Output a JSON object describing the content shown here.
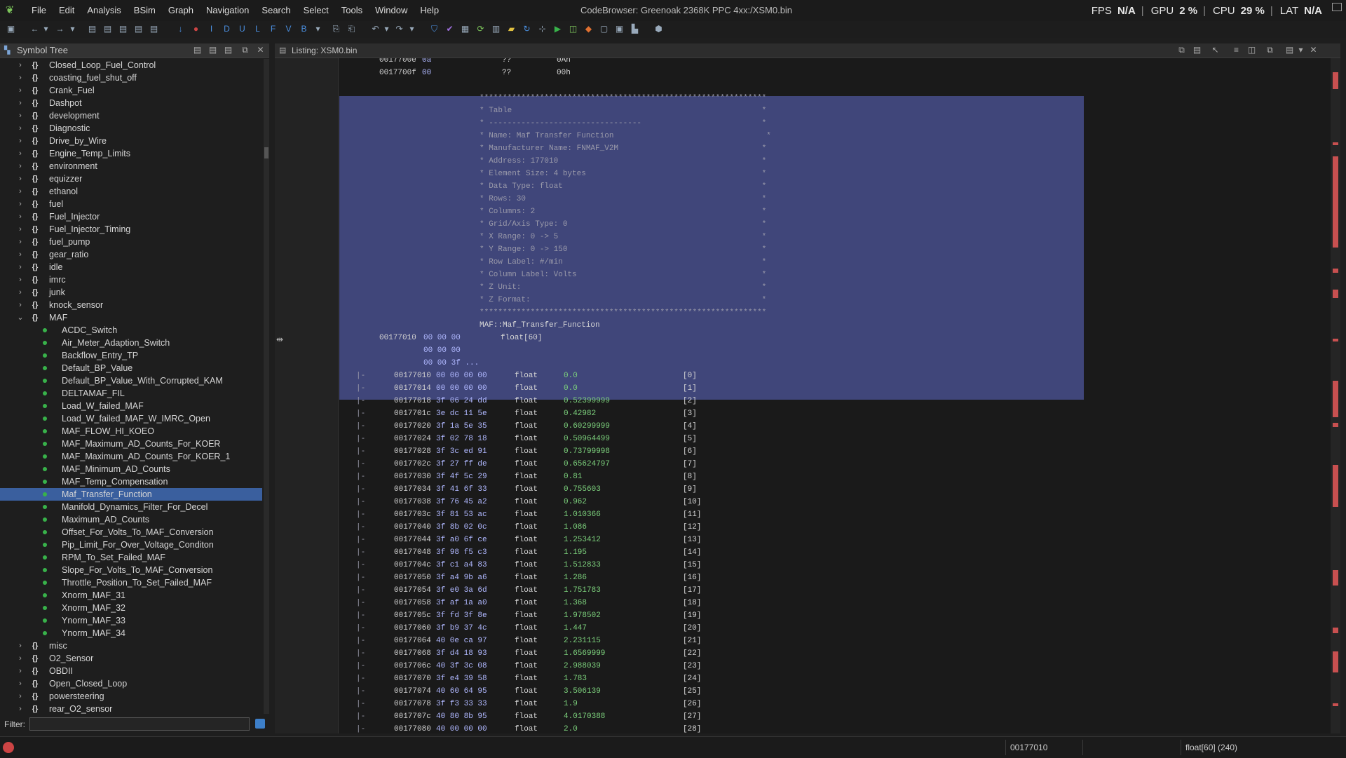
{
  "menubar": {
    "items": [
      "File",
      "Edit",
      "Analysis",
      "BSim",
      "Graph",
      "Navigation",
      "Search",
      "Select",
      "Tools",
      "Window",
      "Help"
    ],
    "title": "CodeBrowser: Greenoak 2368K PPC 4xx:/XSM0.bin",
    "perf": {
      "fps_label": "FPS",
      "fps_value": "N/A",
      "gpu_label": "GPU",
      "gpu_value": "2 %",
      "cpu_label": "CPU",
      "cpu_value": "29 %",
      "lat_label": "LAT",
      "lat_value": "N/A"
    }
  },
  "symbol_tree": {
    "title": "Symbol Tree",
    "filter_label": "Filter:",
    "filter_value": "",
    "items": [
      {
        "label": "Closed_Loop_Fuel_Control",
        "level": 0,
        "kind": "ns",
        "expanded": false
      },
      {
        "label": "coasting_fuel_shut_off",
        "level": 0,
        "kind": "ns",
        "expanded": false
      },
      {
        "label": "Crank_Fuel",
        "level": 0,
        "kind": "ns",
        "expanded": false
      },
      {
        "label": "Dashpot",
        "level": 0,
        "kind": "ns",
        "expanded": false
      },
      {
        "label": "development",
        "level": 0,
        "kind": "ns",
        "expanded": false
      },
      {
        "label": "Diagnostic",
        "level": 0,
        "kind": "ns",
        "expanded": false
      },
      {
        "label": "Drive_by_Wire",
        "level": 0,
        "kind": "ns",
        "expanded": false
      },
      {
        "label": "Engine_Temp_Limits",
        "level": 0,
        "kind": "ns",
        "expanded": false
      },
      {
        "label": "environment",
        "level": 0,
        "kind": "ns",
        "expanded": false
      },
      {
        "label": "equizzer",
        "level": 0,
        "kind": "ns",
        "expanded": false
      },
      {
        "label": "ethanol",
        "level": 0,
        "kind": "ns",
        "expanded": false
      },
      {
        "label": "fuel",
        "level": 0,
        "kind": "ns",
        "expanded": false
      },
      {
        "label": "Fuel_Injector",
        "level": 0,
        "kind": "ns",
        "expanded": false
      },
      {
        "label": "Fuel_Injector_Timing",
        "level": 0,
        "kind": "ns",
        "expanded": false
      },
      {
        "label": "fuel_pump",
        "level": 0,
        "kind": "ns",
        "expanded": false
      },
      {
        "label": "gear_ratio",
        "level": 0,
        "kind": "ns",
        "expanded": false
      },
      {
        "label": "idle",
        "level": 0,
        "kind": "ns",
        "expanded": false
      },
      {
        "label": "imrc",
        "level": 0,
        "kind": "ns",
        "expanded": false
      },
      {
        "label": "junk",
        "level": 0,
        "kind": "ns",
        "expanded": false
      },
      {
        "label": "knock_sensor",
        "level": 0,
        "kind": "ns",
        "expanded": false
      },
      {
        "label": "MAF",
        "level": 0,
        "kind": "ns",
        "expanded": true
      },
      {
        "label": "ACDC_Switch",
        "level": 1,
        "kind": "label"
      },
      {
        "label": "Air_Meter_Adaption_Switch",
        "level": 1,
        "kind": "label"
      },
      {
        "label": "Backflow_Entry_TP",
        "level": 1,
        "kind": "label"
      },
      {
        "label": "Default_BP_Value",
        "level": 1,
        "kind": "label"
      },
      {
        "label": "Default_BP_Value_With_Corrupted_KAM",
        "level": 1,
        "kind": "label"
      },
      {
        "label": "DELTAMAF_FIL",
        "level": 1,
        "kind": "label"
      },
      {
        "label": "Load_W_failed_MAF",
        "level": 1,
        "kind": "label"
      },
      {
        "label": "Load_W_failed_MAF_W_IMRC_Open",
        "level": 1,
        "kind": "label"
      },
      {
        "label": "MAF_FLOW_HI_KOEO",
        "level": 1,
        "kind": "label"
      },
      {
        "label": "MAF_Maximum_AD_Counts_For_KOER",
        "level": 1,
        "kind": "label"
      },
      {
        "label": "MAF_Maximum_AD_Counts_For_KOER_1",
        "level": 1,
        "kind": "label"
      },
      {
        "label": "MAF_Minimum_AD_Counts",
        "level": 1,
        "kind": "label"
      },
      {
        "label": "MAF_Temp_Compensation",
        "level": 1,
        "kind": "label"
      },
      {
        "label": "Maf_Transfer_Function",
        "level": 1,
        "kind": "label",
        "selected": true
      },
      {
        "label": "Manifold_Dynamics_Filter_For_Decel",
        "level": 1,
        "kind": "label"
      },
      {
        "label": "Maximum_AD_Counts",
        "level": 1,
        "kind": "label"
      },
      {
        "label": "Offset_For_Volts_To_MAF_Conversion",
        "level": 1,
        "kind": "label"
      },
      {
        "label": "Pip_Limit_For_Over_Voltage_Conditon",
        "level": 1,
        "kind": "label"
      },
      {
        "label": "RPM_To_Set_Failed_MAF",
        "level": 1,
        "kind": "label"
      },
      {
        "label": "Slope_For_Volts_To_MAF_Conversion",
        "level": 1,
        "kind": "label"
      },
      {
        "label": "Throttle_Position_To_Set_Failed_MAF",
        "level": 1,
        "kind": "label"
      },
      {
        "label": "Xnorm_MAF_31",
        "level": 1,
        "kind": "label"
      },
      {
        "label": "Xnorm_MAF_32",
        "level": 1,
        "kind": "label"
      },
      {
        "label": "Ynorm_MAF_33",
        "level": 1,
        "kind": "label"
      },
      {
        "label": "Ynorm_MAF_34",
        "level": 1,
        "kind": "label"
      },
      {
        "label": "misc",
        "level": 0,
        "kind": "ns",
        "expanded": false
      },
      {
        "label": "O2_Sensor",
        "level": 0,
        "kind": "ns",
        "expanded": false
      },
      {
        "label": "OBDII",
        "level": 0,
        "kind": "ns",
        "expanded": false
      },
      {
        "label": "Open_Closed_Loop",
        "level": 0,
        "kind": "ns",
        "expanded": false
      },
      {
        "label": "powersteering",
        "level": 0,
        "kind": "ns",
        "expanded": false
      },
      {
        "label": "rear_O2_sensor",
        "level": 0,
        "kind": "ns",
        "expanded": false
      }
    ]
  },
  "listing": {
    "title": "Listing:  XSM0.bin",
    "pre_lines": [
      {
        "addr": "0017700e",
        "bytes": "0a",
        "mnem": "??",
        "val": "0Ah"
      },
      {
        "addr": "0017700f",
        "bytes": "00",
        "mnem": "??",
        "val": "00h"
      }
    ],
    "comment_lines": [
      "**************************************************************",
      "* Table                                                      *",
      "* ---------------------------------                          *",
      "* Name: Maf Transfer Function                                 *",
      "* Manufacturer Name: FNMAF_V2M                               *",
      "* Address: 177010                                            *",
      "* Element Size: 4 bytes                                      *",
      "* Data Type: float                                           *",
      "* Rows: 30                                                   *",
      "* Columns: 2                                                 *",
      "* Grid/Axis Type: 0                                          *",
      "* X Range: 0 -> 5                                            *",
      "* Y Range: 0 -> 150                                          *",
      "* Row Label: #/min                                           *",
      "* Column Label: Volts                                        *",
      "* Z Unit:                                                    *",
      "* Z Format:                                                  *",
      "**************************************************************"
    ],
    "label_line": "MAF::Maf_Transfer_Function",
    "array_line": {
      "addr": "00177010",
      "bytes": [
        "00 00 00",
        "00 00 00",
        "00 00 3f ..."
      ],
      "type": "float[60]"
    },
    "rows": [
      {
        "addr": "00177010",
        "bytes": "00 00 00 00",
        "mnem": "float",
        "val": "0.0",
        "idx": "[0]"
      },
      {
        "addr": "00177014",
        "bytes": "00 00 00 00",
        "mnem": "float",
        "val": "0.0",
        "idx": "[1]"
      },
      {
        "addr": "00177018",
        "bytes": "3f 06 24 dd",
        "mnem": "float",
        "val": "0.52399999",
        "idx": "[2]"
      },
      {
        "addr": "0017701c",
        "bytes": "3e dc 11 5e",
        "mnem": "float",
        "val": "0.42982",
        "idx": "[3]"
      },
      {
        "addr": "00177020",
        "bytes": "3f 1a 5e 35",
        "mnem": "float",
        "val": "0.60299999",
        "idx": "[4]"
      },
      {
        "addr": "00177024",
        "bytes": "3f 02 78 18",
        "mnem": "float",
        "val": "0.50964499",
        "idx": "[5]"
      },
      {
        "addr": "00177028",
        "bytes": "3f 3c ed 91",
        "mnem": "float",
        "val": "0.73799998",
        "idx": "[6]"
      },
      {
        "addr": "0017702c",
        "bytes": "3f 27 ff de",
        "mnem": "float",
        "val": "0.65624797",
        "idx": "[7]"
      },
      {
        "addr": "00177030",
        "bytes": "3f 4f 5c 29",
        "mnem": "float",
        "val": "0.81",
        "idx": "[8]"
      },
      {
        "addr": "00177034",
        "bytes": "3f 41 6f 33",
        "mnem": "float",
        "val": "0.755603",
        "idx": "[9]"
      },
      {
        "addr": "00177038",
        "bytes": "3f 76 45 a2",
        "mnem": "float",
        "val": "0.962",
        "idx": "[10]"
      },
      {
        "addr": "0017703c",
        "bytes": "3f 81 53 ac",
        "mnem": "float",
        "val": "1.010366",
        "idx": "[11]"
      },
      {
        "addr": "00177040",
        "bytes": "3f 8b 02 0c",
        "mnem": "float",
        "val": "1.086",
        "idx": "[12]"
      },
      {
        "addr": "00177044",
        "bytes": "3f a0 6f ce",
        "mnem": "float",
        "val": "1.253412",
        "idx": "[13]"
      },
      {
        "addr": "00177048",
        "bytes": "3f 98 f5 c3",
        "mnem": "float",
        "val": "1.195",
        "idx": "[14]"
      },
      {
        "addr": "0017704c",
        "bytes": "3f c1 a4 83",
        "mnem": "float",
        "val": "1.512833",
        "idx": "[15]"
      },
      {
        "addr": "00177050",
        "bytes": "3f a4 9b a6",
        "mnem": "float",
        "val": "1.286",
        "idx": "[16]"
      },
      {
        "addr": "00177054",
        "bytes": "3f e0 3a 6d",
        "mnem": "float",
        "val": "1.751783",
        "idx": "[17]"
      },
      {
        "addr": "00177058",
        "bytes": "3f af 1a a0",
        "mnem": "float",
        "val": "1.368",
        "idx": "[18]"
      },
      {
        "addr": "0017705c",
        "bytes": "3f fd 3f 8e",
        "mnem": "float",
        "val": "1.978502",
        "idx": "[19]"
      },
      {
        "addr": "00177060",
        "bytes": "3f b9 37 4c",
        "mnem": "float",
        "val": "1.447",
        "idx": "[20]"
      },
      {
        "addr": "00177064",
        "bytes": "40 0e ca 97",
        "mnem": "float",
        "val": "2.231115",
        "idx": "[21]"
      },
      {
        "addr": "00177068",
        "bytes": "3f d4 18 93",
        "mnem": "float",
        "val": "1.6569999",
        "idx": "[22]"
      },
      {
        "addr": "0017706c",
        "bytes": "40 3f 3c 08",
        "mnem": "float",
        "val": "2.988039",
        "idx": "[23]"
      },
      {
        "addr": "00177070",
        "bytes": "3f e4 39 58",
        "mnem": "float",
        "val": "1.783",
        "idx": "[24]"
      },
      {
        "addr": "00177074",
        "bytes": "40 60 64 95",
        "mnem": "float",
        "val": "3.506139",
        "idx": "[25]"
      },
      {
        "addr": "00177078",
        "bytes": "3f f3 33 33",
        "mnem": "float",
        "val": "1.9",
        "idx": "[26]"
      },
      {
        "addr": "0017707c",
        "bytes": "40 80 8b 95",
        "mnem": "float",
        "val": "4.0170388",
        "idx": "[27]"
      },
      {
        "addr": "00177080",
        "bytes": "40 00 00 00",
        "mnem": "float",
        "val": "2.0",
        "idx": "[28]"
      }
    ]
  },
  "statusbar": {
    "address": "00177010",
    "type_info": "float[60]  (240)"
  },
  "colors": {
    "selection": "#40467a",
    "tree_selected": "#3a5f9e",
    "value_green": "#7cd07c",
    "bytes_blue": "#b0b8ff",
    "label_dot": "#38b24a"
  }
}
